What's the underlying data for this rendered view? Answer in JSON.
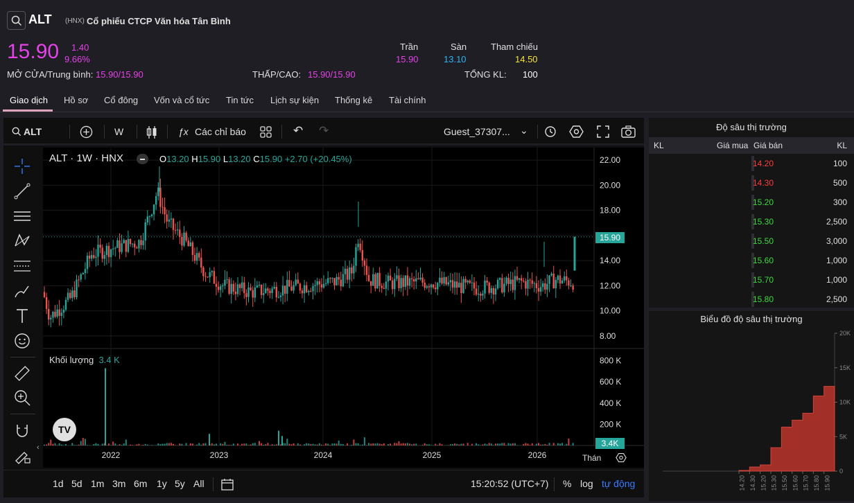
{
  "header": {
    "ticker": "ALT",
    "exchange": "(HNX)",
    "company_name": "Cổ phiếu CTCP Văn hóa Tân Bình",
    "price": "15.90",
    "change": "1.40",
    "change_pct": "9.66%",
    "open_avg_label": "MỞ CỬA/Trung bình:",
    "open_avg_value": "15.90/15.90",
    "low_high_label": "THẤP/CAO:",
    "low_high_value": "15.90/15.90",
    "ceiling_label": "Trần",
    "ceiling_value": "15.90",
    "floor_label": "Sàn",
    "floor_value": "13.10",
    "ref_label": "Tham chiếu",
    "ref_value": "14.50",
    "total_vol_label": "TỔNG KL:",
    "total_vol_value": "100"
  },
  "tabs": [
    "Giao dịch",
    "Hồ sơ",
    "Cổ đông",
    "Vốn và cổ tức",
    "Tin tức",
    "Lịch sự kiện",
    "Thống kê",
    "Tài chính"
  ],
  "toolbar": {
    "symbol": "ALT",
    "interval": "W",
    "indicators": "Các chỉ báo",
    "user": "Guest_37307..."
  },
  "legend": {
    "title": "ALT · 1W · HNX",
    "o_label": "O",
    "o": "13.20",
    "h_label": "H",
    "h": "15.90",
    "l_label": "L",
    "l": "13.20",
    "c_label": "C",
    "c": "15.90",
    "chg": "+2.70 (+20.45%)",
    "volume_label": "Khối lượng",
    "volume_value": "3.4 K"
  },
  "price_axis": [
    "22.00",
    "20.00",
    "18.00",
    "16.00",
    "14.00",
    "12.00",
    "10.00",
    "8.00"
  ],
  "price_badge": "15.90",
  "volume_axis": [
    "800 K",
    "600 K",
    "400 K",
    "200 K"
  ],
  "volume_badge": "3.4K",
  "time_axis": [
    "2022",
    "2023",
    "2024",
    "2025",
    "2026"
  ],
  "time_axis_more": "Thán",
  "bottom": {
    "ranges": [
      "1d",
      "5d",
      "1m",
      "3m",
      "6m",
      "1y",
      "5y",
      "All"
    ],
    "clock": "15:20:52 (UTC+7)",
    "pct": "%",
    "log": "log",
    "auto": "tự động"
  },
  "depth": {
    "title": "Độ sâu thị trường",
    "cols": [
      "KL",
      "Giá mua",
      "Giá bán",
      "KL"
    ],
    "rows": [
      {
        "price": "14.20",
        "vol": "100",
        "color": "#ff3b3b"
      },
      {
        "price": "14.30",
        "vol": "500",
        "color": "#ff3b3b"
      },
      {
        "price": "15.20",
        "vol": "300",
        "color": "#3bdc3b"
      },
      {
        "price": "15.30",
        "vol": "2,500",
        "color": "#3bdc3b"
      },
      {
        "price": "15.50",
        "vol": "3,000",
        "color": "#3bdc3b"
      },
      {
        "price": "15.60",
        "vol": "1,000",
        "color": "#3bdc3b"
      },
      {
        "price": "15.70",
        "vol": "1,000",
        "color": "#3bdc3b"
      },
      {
        "price": "15.80",
        "vol": "2,500",
        "color": "#3bdc3b"
      }
    ]
  },
  "depth_chart": {
    "title": "Biểu đồ độ sâu thị trường",
    "y_ticks": [
      "20K",
      "15K",
      "10K",
      "5K",
      "0"
    ],
    "x_ticks": [
      "14.20",
      "14.30",
      "15.20",
      "15.30",
      "15.50",
      "15.60",
      "15.70",
      "15.80",
      "15.90"
    ]
  },
  "chart_data": [
    {
      "type": "candlestick",
      "title": "ALT · 1W · HNX",
      "x_labels": [
        "2022",
        "2023",
        "2024",
        "2025",
        "2026"
      ],
      "ylim": [
        7,
        23
      ],
      "approx_close_by_year": [
        {
          "x": "2022",
          "y": 14.5
        },
        {
          "x": "2023",
          "y": 12.0
        },
        {
          "x": "2024",
          "y": 12.5
        },
        {
          "x": "2025",
          "y": 12.0
        },
        {
          "x": "2026",
          "y": 13.5
        }
      ],
      "last": {
        "open": 13.2,
        "high": 15.9,
        "low": 13.2,
        "close": 15.9
      }
    },
    {
      "type": "bar",
      "title": "Khối lượng",
      "ylim": [
        0,
        850000
      ],
      "peak_value": 730000,
      "last_value": 3400
    },
    {
      "type": "area",
      "title": "Biểu đồ độ sâu thị trường",
      "categories": [
        "14.20",
        "14.30",
        "15.20",
        "15.30",
        "15.50",
        "15.60",
        "15.70",
        "15.80",
        "15.90"
      ],
      "values": [
        100,
        600,
        900,
        3400,
        6400,
        7400,
        8400,
        10900,
        12300
      ],
      "ylim": [
        0,
        20000
      ]
    }
  ]
}
